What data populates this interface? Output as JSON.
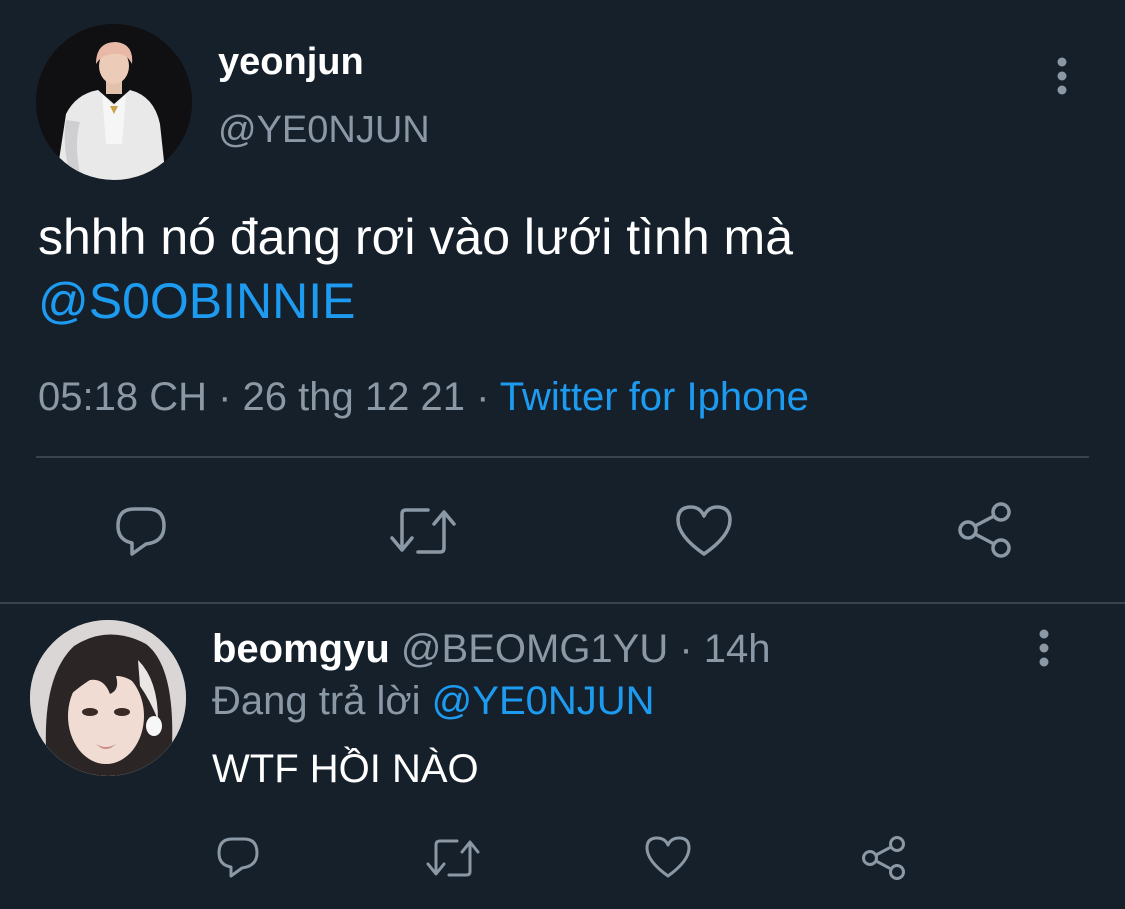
{
  "main_tweet": {
    "display_name": "yeonjun",
    "handle": "@YE0NJUN",
    "text": "shhh nó đang rơi vào lưới tình mà",
    "mention": "@S0OBINNIE",
    "time": "05:18 CH",
    "separator": " · ",
    "date": "26 thg 12 21",
    "separator2": " · ",
    "source": "Twitter for Iphone",
    "icons": {
      "more": "more-vertical-icon",
      "reply": "reply-icon",
      "retweet": "retweet-icon",
      "like": "heart-icon",
      "share": "share-icon"
    }
  },
  "reply_tweet": {
    "display_name": "beomgyu",
    "handle": "@BEOMG1YU",
    "separator": " · ",
    "time": "14h",
    "replying_to_label": "Đang trả lời",
    "replying_to_handle": "@YE0NJUN",
    "text": "WTF HỒI NÀO"
  },
  "colors": {
    "background": "#15202b",
    "accent": "#1d9bf0",
    "muted": "#8b98a5",
    "divider": "#38444d"
  }
}
